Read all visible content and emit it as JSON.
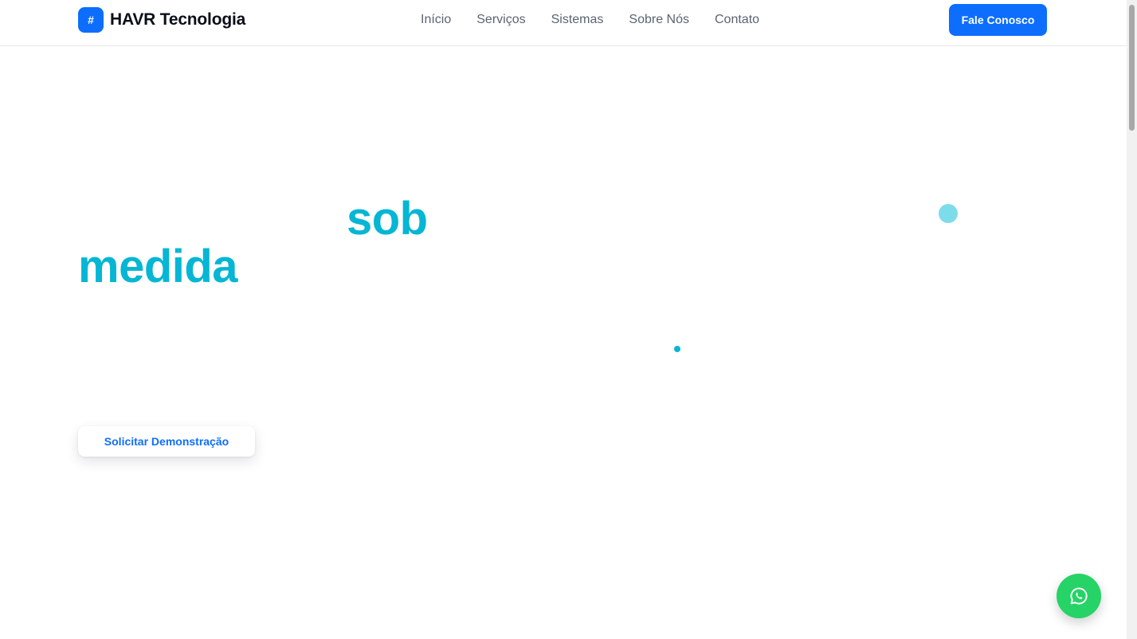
{
  "brand": {
    "logo_symbol": "#",
    "name": "HAVR Tecnologia"
  },
  "nav": {
    "links": [
      "Início",
      "Serviços",
      "Sistemas",
      "Sobre Nós",
      "Contato"
    ]
  },
  "header": {
    "cta_label": "Fale Conosco"
  },
  "hero": {
    "word_sob": "sob",
    "word_medida": "medida",
    "demo_button": "Solicitar Demonstração"
  },
  "floating": {
    "icon": "whatsapp-icon"
  },
  "colors": {
    "primary": "#0d6efd",
    "accent": "#06b6d4",
    "whatsapp": "#25d366"
  }
}
